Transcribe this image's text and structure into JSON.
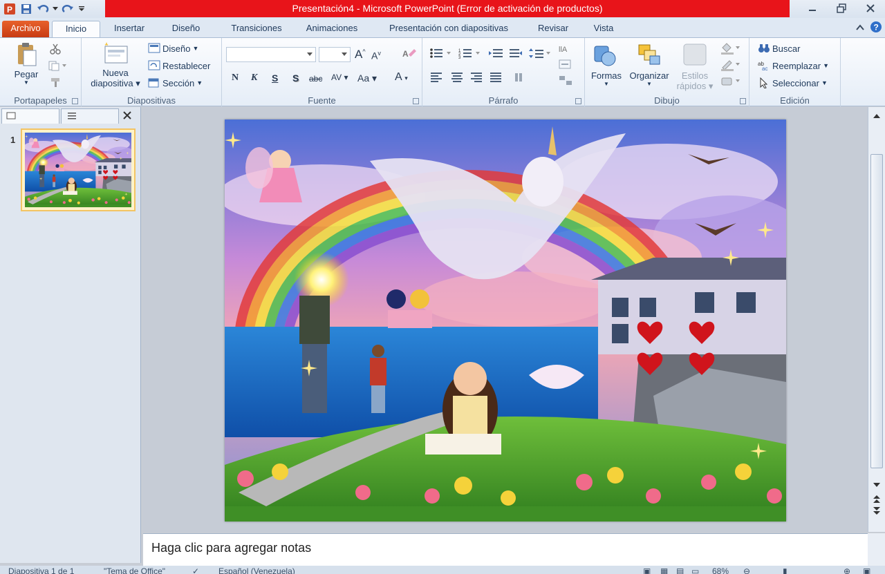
{
  "window": {
    "title": "Presentación4  -  Microsoft PowerPoint (Error de activación de productos)"
  },
  "tabs": {
    "file": "Archivo",
    "items": [
      "Inicio",
      "Insertar",
      "Diseño",
      "Transiciones",
      "Animaciones",
      "Presentación con diapositivas",
      "Revisar",
      "Vista"
    ],
    "active": "Inicio"
  },
  "ribbon": {
    "clipboard": {
      "paste": "Pegar",
      "label": "Portapapeles"
    },
    "slides": {
      "new_slide_1": "Nueva",
      "new_slide_2": "diapositiva",
      "layout": "Diseño",
      "reset": "Restablecer",
      "section": "Sección",
      "label": "Diapositivas"
    },
    "font": {
      "label": "Fuente",
      "bold": "N",
      "italic": "K",
      "underline": "S",
      "shadow": "S",
      "strike": "abc",
      "spacing": "AV",
      "case": "Aa",
      "color": "A",
      "grow": "A",
      "shrink": "A"
    },
    "paragraph": {
      "label": "Párrafo"
    },
    "drawing": {
      "shapes": "Formas",
      "arrange": "Organizar",
      "quick_styles_1": "Estilos",
      "quick_styles_2": "rápidos",
      "label": "Dibujo"
    },
    "editing": {
      "find": "Buscar",
      "replace": "Reemplazar",
      "select": "Seleccionar",
      "label": "Edición"
    }
  },
  "slides_panel": {
    "slide_number": "1"
  },
  "notes": {
    "placeholder": "Haga clic para agregar notas"
  },
  "statusbar": {
    "slide_info": "Diapositiva 1 de 1",
    "theme": "\"Tema de Office\"",
    "language": "Español (Venezuela)",
    "zoom": "68%"
  },
  "colors": {
    "title_error_bar": "#e8141a",
    "file_tab": "#d9471c",
    "ribbon_bg": "#eef3fa"
  }
}
